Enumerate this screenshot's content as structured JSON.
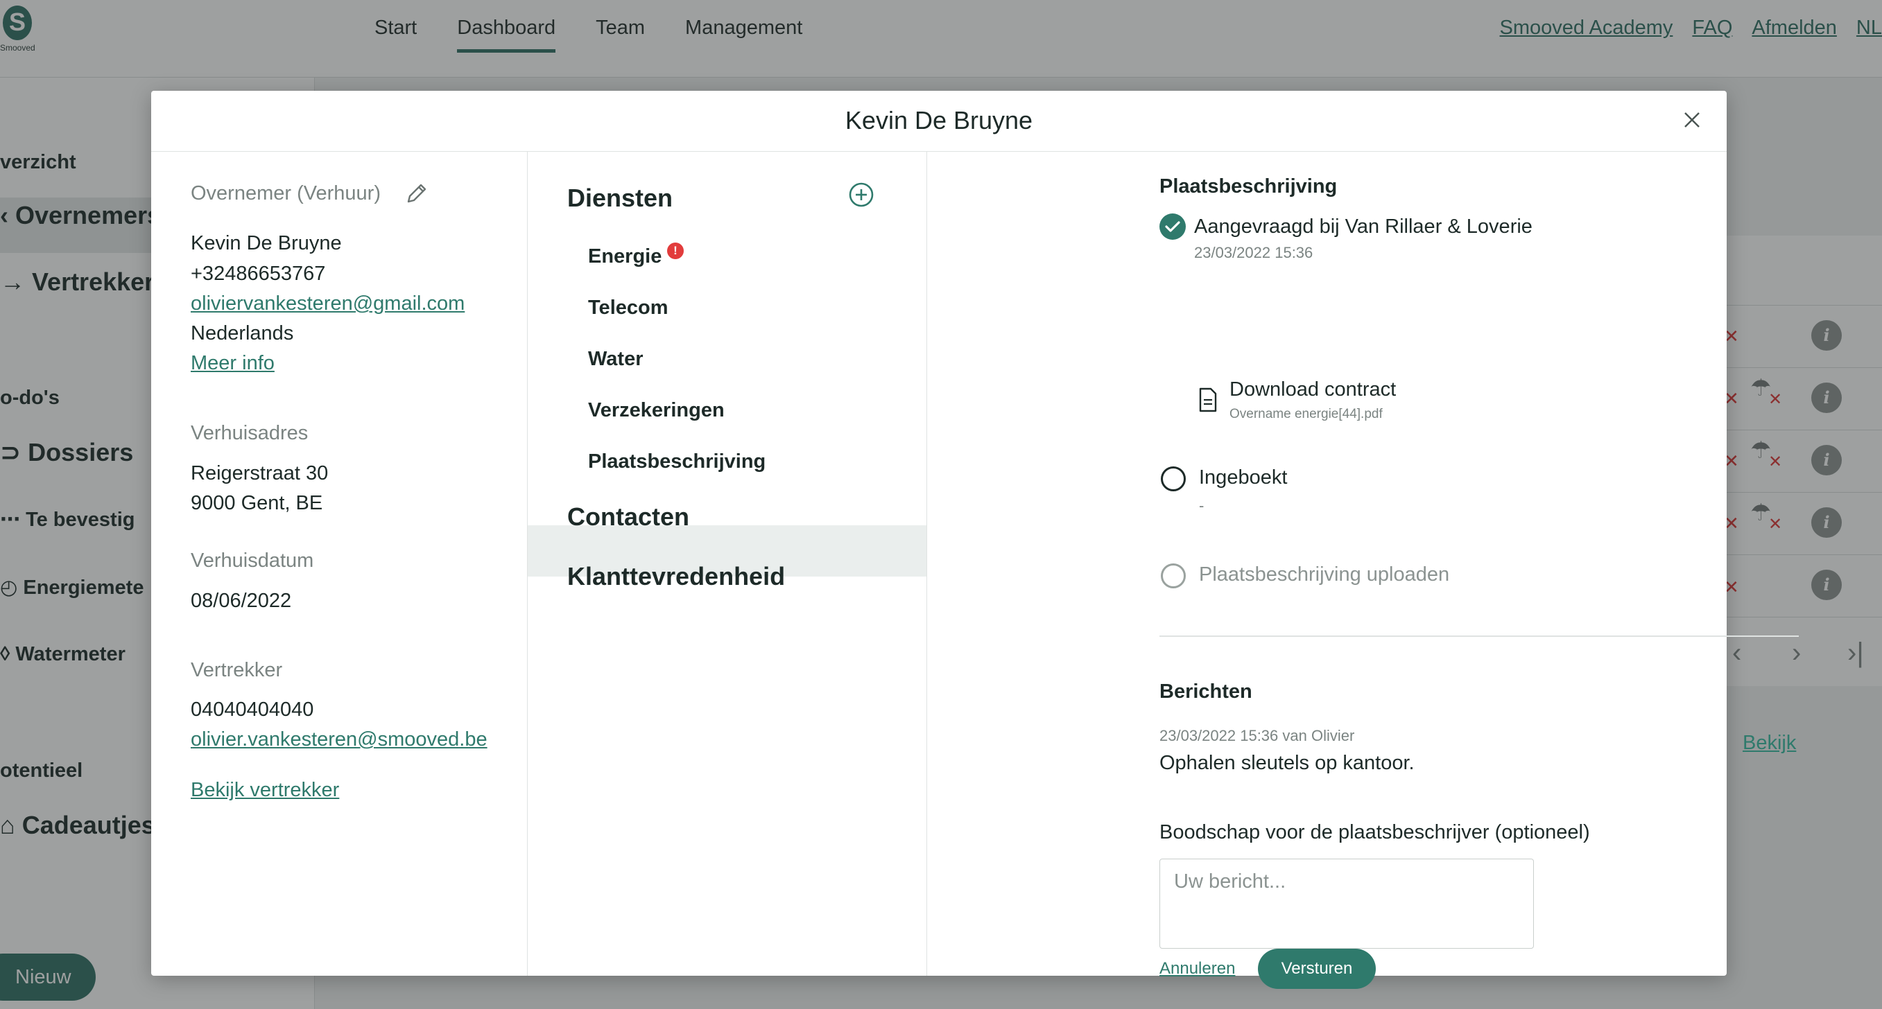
{
  "app": {
    "logo_letter": "S",
    "logo_text": "Smooved",
    "brand_color": "#2f6d63",
    "nav": [
      "Start",
      "Dashboard",
      "Team",
      "Management"
    ],
    "nav_active": "Dashboard",
    "top_links": [
      "Smooved Academy",
      "FAQ",
      "Afmelden",
      "NL"
    ]
  },
  "sidebar": {
    "overzicht": "verzicht",
    "overnemers": "Overnemers",
    "vertrekkers": "Vertrekkers",
    "todos": "o-do's",
    "dossiers": "Dossiers",
    "te_bevestigen": "Te bevestig",
    "energiemeters": "Energiemete",
    "watermeters": "Watermeter",
    "potentieel": "otentieel",
    "cadeautjes": "Cadeautjes",
    "nieuw": "Nieuw"
  },
  "modal": {
    "title": "Kevin De Bruyne",
    "left": {
      "role_label": "Overnemer (Verhuur)",
      "name": "Kevin De Bruyne",
      "phone": "+32486653767",
      "email": "oliviervankesteren@gmail.com",
      "language": "Nederlands",
      "more_info": "Meer info",
      "address_label": "Verhuisadres",
      "address_line1": "Reigerstraat 30",
      "address_line2": "9000 Gent, BE",
      "date_label": "Verhuisdatum",
      "date": "08/06/2022",
      "leaver_label": "Vertrekker",
      "leaver_phone": "04040404040",
      "leaver_email": "olivier.vankesteren@smooved.be",
      "leaver_link": "Bekijk vertrekker"
    },
    "middle": {
      "services_heading": "Diensten",
      "services": [
        "Energie",
        "Telecom",
        "Water",
        "Verzekeringen",
        "Plaatsbeschrijving"
      ],
      "active_service": "Plaatsbeschrijving",
      "energie_alert": "!",
      "contacts_heading": "Contacten",
      "satisfaction_heading": "Klanttevredenheid"
    },
    "right": {
      "heading": "Plaatsbeschrijving",
      "step1_label": "Aangevraagd bij Van Rillaer & Loverie",
      "step1_date": "23/03/2022 15:36",
      "download_label": "Download contract",
      "download_file": "Overname energie[44].pdf",
      "step2_label": "Ingeboekt",
      "step2_value": "-",
      "step3_label": "Plaatsbeschrijving uploaden",
      "messages_heading": "Berichten",
      "message_meta": "23/03/2022 15:36 van Olivier",
      "message_text": "Ophalen sleutels op kantoor.",
      "message_link": "Bekijk",
      "note_label": "Boodschap voor de plaatsbeschrijver (optioneel)",
      "note_placeholder": "Uw bericht...",
      "cancel_label": "Annuleren",
      "send_label": "Versturen"
    }
  }
}
